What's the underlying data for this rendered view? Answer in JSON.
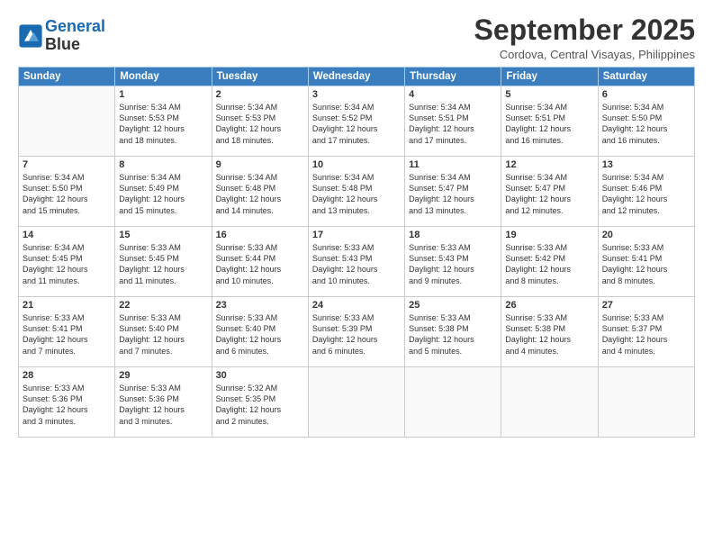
{
  "header": {
    "logo_line1": "General",
    "logo_line2": "Blue",
    "month_title": "September 2025",
    "location": "Cordova, Central Visayas, Philippines"
  },
  "weekdays": [
    "Sunday",
    "Monday",
    "Tuesday",
    "Wednesday",
    "Thursday",
    "Friday",
    "Saturday"
  ],
  "weeks": [
    [
      {
        "day": "",
        "info": ""
      },
      {
        "day": "1",
        "info": "Sunrise: 5:34 AM\nSunset: 5:53 PM\nDaylight: 12 hours\nand 18 minutes."
      },
      {
        "day": "2",
        "info": "Sunrise: 5:34 AM\nSunset: 5:53 PM\nDaylight: 12 hours\nand 18 minutes."
      },
      {
        "day": "3",
        "info": "Sunrise: 5:34 AM\nSunset: 5:52 PM\nDaylight: 12 hours\nand 17 minutes."
      },
      {
        "day": "4",
        "info": "Sunrise: 5:34 AM\nSunset: 5:51 PM\nDaylight: 12 hours\nand 17 minutes."
      },
      {
        "day": "5",
        "info": "Sunrise: 5:34 AM\nSunset: 5:51 PM\nDaylight: 12 hours\nand 16 minutes."
      },
      {
        "day": "6",
        "info": "Sunrise: 5:34 AM\nSunset: 5:50 PM\nDaylight: 12 hours\nand 16 minutes."
      }
    ],
    [
      {
        "day": "7",
        "info": "Sunrise: 5:34 AM\nSunset: 5:50 PM\nDaylight: 12 hours\nand 15 minutes."
      },
      {
        "day": "8",
        "info": "Sunrise: 5:34 AM\nSunset: 5:49 PM\nDaylight: 12 hours\nand 15 minutes."
      },
      {
        "day": "9",
        "info": "Sunrise: 5:34 AM\nSunset: 5:48 PM\nDaylight: 12 hours\nand 14 minutes."
      },
      {
        "day": "10",
        "info": "Sunrise: 5:34 AM\nSunset: 5:48 PM\nDaylight: 12 hours\nand 13 minutes."
      },
      {
        "day": "11",
        "info": "Sunrise: 5:34 AM\nSunset: 5:47 PM\nDaylight: 12 hours\nand 13 minutes."
      },
      {
        "day": "12",
        "info": "Sunrise: 5:34 AM\nSunset: 5:47 PM\nDaylight: 12 hours\nand 12 minutes."
      },
      {
        "day": "13",
        "info": "Sunrise: 5:34 AM\nSunset: 5:46 PM\nDaylight: 12 hours\nand 12 minutes."
      }
    ],
    [
      {
        "day": "14",
        "info": "Sunrise: 5:34 AM\nSunset: 5:45 PM\nDaylight: 12 hours\nand 11 minutes."
      },
      {
        "day": "15",
        "info": "Sunrise: 5:33 AM\nSunset: 5:45 PM\nDaylight: 12 hours\nand 11 minutes."
      },
      {
        "day": "16",
        "info": "Sunrise: 5:33 AM\nSunset: 5:44 PM\nDaylight: 12 hours\nand 10 minutes."
      },
      {
        "day": "17",
        "info": "Sunrise: 5:33 AM\nSunset: 5:43 PM\nDaylight: 12 hours\nand 10 minutes."
      },
      {
        "day": "18",
        "info": "Sunrise: 5:33 AM\nSunset: 5:43 PM\nDaylight: 12 hours\nand 9 minutes."
      },
      {
        "day": "19",
        "info": "Sunrise: 5:33 AM\nSunset: 5:42 PM\nDaylight: 12 hours\nand 8 minutes."
      },
      {
        "day": "20",
        "info": "Sunrise: 5:33 AM\nSunset: 5:41 PM\nDaylight: 12 hours\nand 8 minutes."
      }
    ],
    [
      {
        "day": "21",
        "info": "Sunrise: 5:33 AM\nSunset: 5:41 PM\nDaylight: 12 hours\nand 7 minutes."
      },
      {
        "day": "22",
        "info": "Sunrise: 5:33 AM\nSunset: 5:40 PM\nDaylight: 12 hours\nand 7 minutes."
      },
      {
        "day": "23",
        "info": "Sunrise: 5:33 AM\nSunset: 5:40 PM\nDaylight: 12 hours\nand 6 minutes."
      },
      {
        "day": "24",
        "info": "Sunrise: 5:33 AM\nSunset: 5:39 PM\nDaylight: 12 hours\nand 6 minutes."
      },
      {
        "day": "25",
        "info": "Sunrise: 5:33 AM\nSunset: 5:38 PM\nDaylight: 12 hours\nand 5 minutes."
      },
      {
        "day": "26",
        "info": "Sunrise: 5:33 AM\nSunset: 5:38 PM\nDaylight: 12 hours\nand 4 minutes."
      },
      {
        "day": "27",
        "info": "Sunrise: 5:33 AM\nSunset: 5:37 PM\nDaylight: 12 hours\nand 4 minutes."
      }
    ],
    [
      {
        "day": "28",
        "info": "Sunrise: 5:33 AM\nSunset: 5:36 PM\nDaylight: 12 hours\nand 3 minutes."
      },
      {
        "day": "29",
        "info": "Sunrise: 5:33 AM\nSunset: 5:36 PM\nDaylight: 12 hours\nand 3 minutes."
      },
      {
        "day": "30",
        "info": "Sunrise: 5:32 AM\nSunset: 5:35 PM\nDaylight: 12 hours\nand 2 minutes."
      },
      {
        "day": "",
        "info": ""
      },
      {
        "day": "",
        "info": ""
      },
      {
        "day": "",
        "info": ""
      },
      {
        "day": "",
        "info": ""
      }
    ]
  ]
}
